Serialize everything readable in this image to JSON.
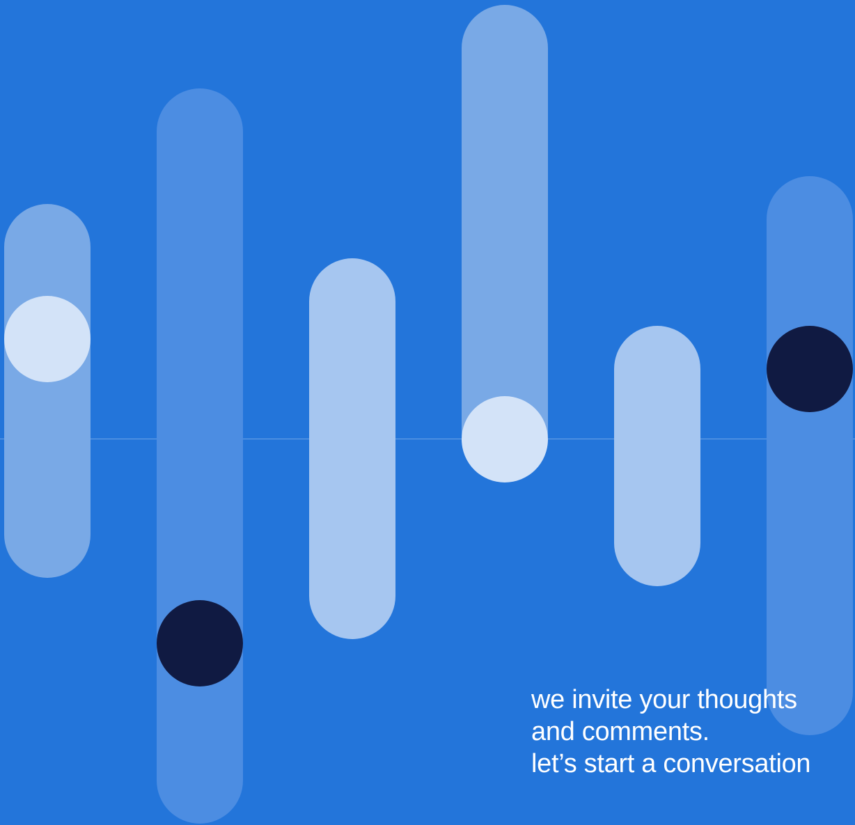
{
  "colors": {
    "background": "#2375DA",
    "bar_mid": "#4C8DE2",
    "bar_light": "#79A9E6",
    "bar_lighter": "#A6C6F0",
    "dot_light": "#D3E3F8",
    "dot_dark": "#101A42"
  },
  "message": {
    "line1": "we invite your thoughts",
    "line2": "and comments.",
    "line3": "let’s start a conversation"
  }
}
